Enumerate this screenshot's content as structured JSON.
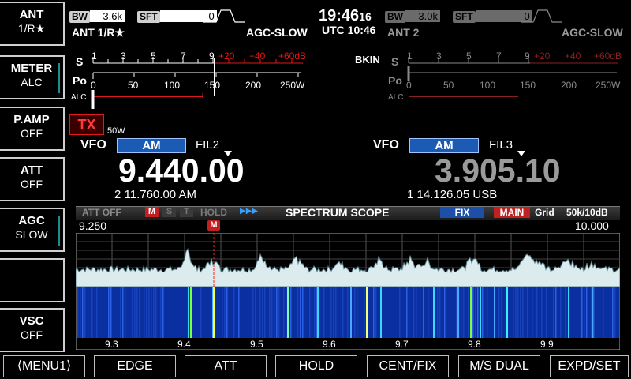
{
  "left_buttons": [
    {
      "name": "ant-button",
      "line1": "ANT",
      "line2": "1/R★"
    },
    {
      "name": "meter-button",
      "line1": "METER",
      "line2": "ALC"
    },
    {
      "name": "pamp-button",
      "line1": "P.AMP",
      "line2": "OFF"
    },
    {
      "name": "att-side-button",
      "line1": "ATT",
      "line2": "OFF"
    },
    {
      "name": "agc-button",
      "line1": "AGC",
      "line2": "SLOW"
    },
    {
      "name": "blank-button",
      "line1": "",
      "line2": ""
    },
    {
      "name": "vsc-button",
      "line1": "VSC",
      "line2": "OFF"
    }
  ],
  "main_rx": {
    "bw_label": "BW",
    "bw_value": "3.6k",
    "sft_label": "SFT",
    "sft_value": "0",
    "ant": "ANT 1/R★",
    "agc": "AGC-SLOW",
    "vfo": "VFO",
    "mode": "AM",
    "filter": "FIL2",
    "frequency": "9.440.00",
    "sub_line": "2  11.760.00  AM",
    "tx": "TX",
    "power": "50W"
  },
  "sub_rx": {
    "bw_label": "BW",
    "bw_value": "3.0k",
    "sft_label": "SFT",
    "sft_value": "0",
    "ant": "ANT 2",
    "agc": "AGC-SLOW",
    "vfo": "VFO",
    "mode": "AM",
    "filter": "FIL3",
    "frequency": "3.905.10",
    "sub_line": "1  14.126.05  USB",
    "bkin": "BKIN"
  },
  "clock": {
    "time": "19:46",
    "seconds": "16",
    "utc": "UTC 10:46"
  },
  "meter": {
    "s_label": "S",
    "po_label": "Po",
    "alc_label": "ALC",
    "s_ticks": [
      "1",
      "3",
      "5",
      "7",
      "9",
      "+20",
      "+40",
      "+60dB"
    ],
    "po_ticks": [
      "0",
      "50",
      "100",
      "150",
      "200",
      "250W"
    ]
  },
  "scope": {
    "att": "ATT OFF",
    "m": "M",
    "s": "S",
    "t": "T",
    "hold": "HOLD",
    "arrows": "▶▶▶",
    "title": "SPECTRUM  SCOPE",
    "fix": "FIX",
    "main": "MAIN",
    "grid": "Grid",
    "span": "50k/10dB",
    "start": "9.250",
    "end": "10.000",
    "marker": "M",
    "axis": [
      "9.3",
      "9.4",
      "9.5",
      "9.6",
      "9.7",
      "9.8",
      "9.9"
    ]
  },
  "menu": [
    "⟨MENU1⟩",
    "EDGE",
    "ATT",
    "HOLD",
    "CENT/FIX",
    "M/S  DUAL",
    "EXPD/SET"
  ],
  "colors": {
    "mode_blue": "#1b5bb3",
    "red": "#e01818",
    "cyan": "#1a8f8f",
    "waterfall_blue": "#0a2fa0"
  }
}
